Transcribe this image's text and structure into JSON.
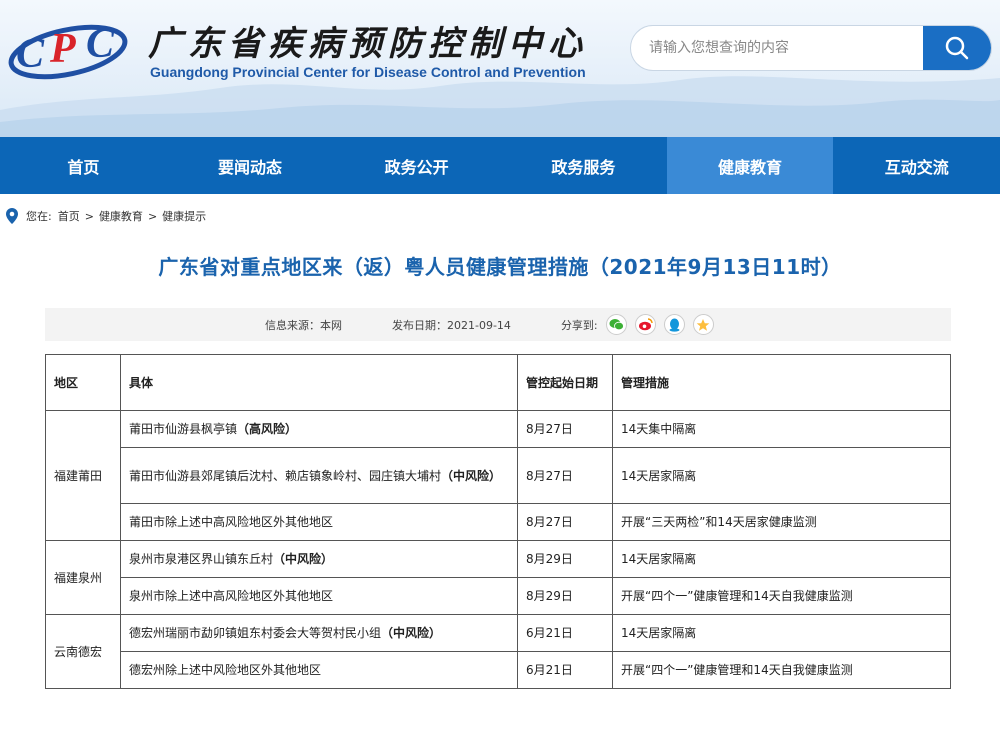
{
  "header": {
    "title_cn": "广东省疾病预防控制中心",
    "title_en": "Guangdong Provincial Center for Disease Control and Prevention",
    "search_placeholder": "请输入您想查询的内容"
  },
  "nav": [
    "首页",
    "要闻动态",
    "政务公开",
    "政务服务",
    "健康教育",
    "互动交流"
  ],
  "nav_active": 4,
  "breadcrumb": {
    "label": "您在:",
    "items": [
      "首页",
      "健康教育",
      "健康提示"
    ],
    "separator": ">"
  },
  "article": {
    "title": "广东省对重点地区来（返）粤人员健康管理措施（2021年9月13日11时）",
    "source": "信息来源：本网",
    "date": "发布日期：2021-09-14",
    "share_label": "分享到:"
  },
  "table": {
    "headers": [
      "地区",
      "具体",
      "管控起始日期",
      "管理措施"
    ],
    "groups": [
      {
        "region": "福建莆田",
        "rows": [
          {
            "detail": "莆田市仙游县枫亭镇",
            "risk": "（高风险）",
            "date": "8月27日",
            "measure": "14天集中隔离"
          },
          {
            "detail": "莆田市仙游县郊尾镇后沈村、赖店镇象岭村、园庄镇大埔村",
            "risk": "（中风险）",
            "date": "8月27日",
            "measure": "14天居家隔离"
          },
          {
            "detail": "莆田市除上述中高风险地区外其他地区",
            "risk": "",
            "date": "8月27日",
            "measure": "开展“三天两检”和14天居家健康监测"
          }
        ]
      },
      {
        "region": "福建泉州",
        "rows": [
          {
            "detail": "泉州市泉港区界山镇东丘村",
            "risk": "（中风险）",
            "date": "8月29日",
            "measure": "14天居家隔离"
          },
          {
            "detail": "泉州市除上述中高风险地区外其他地区",
            "risk": "",
            "date": "8月29日",
            "measure": "开展“四个一”健康管理和14天自我健康监测"
          }
        ]
      },
      {
        "region": "云南德宏",
        "rows": [
          {
            "detail": "德宏州瑞丽市勐卯镇姐东村委会大等贺村民小组",
            "risk": "（中风险）",
            "date": "6月21日",
            "measure": "14天居家隔离"
          },
          {
            "detail": "德宏州除上述中风险地区外其他地区",
            "risk": "",
            "date": "6月21日",
            "measure": "开展“四个一”健康管理和14天自我健康监测"
          }
        ]
      }
    ]
  },
  "colors": {
    "nav_bg": "#0c66b7",
    "nav_active": "#3a8ad6",
    "title": "#1a63ad",
    "search_btn": "#1a6ec4"
  },
  "icons": [
    "cdc-logo",
    "search-icon",
    "location-pin-icon",
    "wechat-icon",
    "weibo-icon",
    "qq-icon",
    "qzone-icon"
  ]
}
